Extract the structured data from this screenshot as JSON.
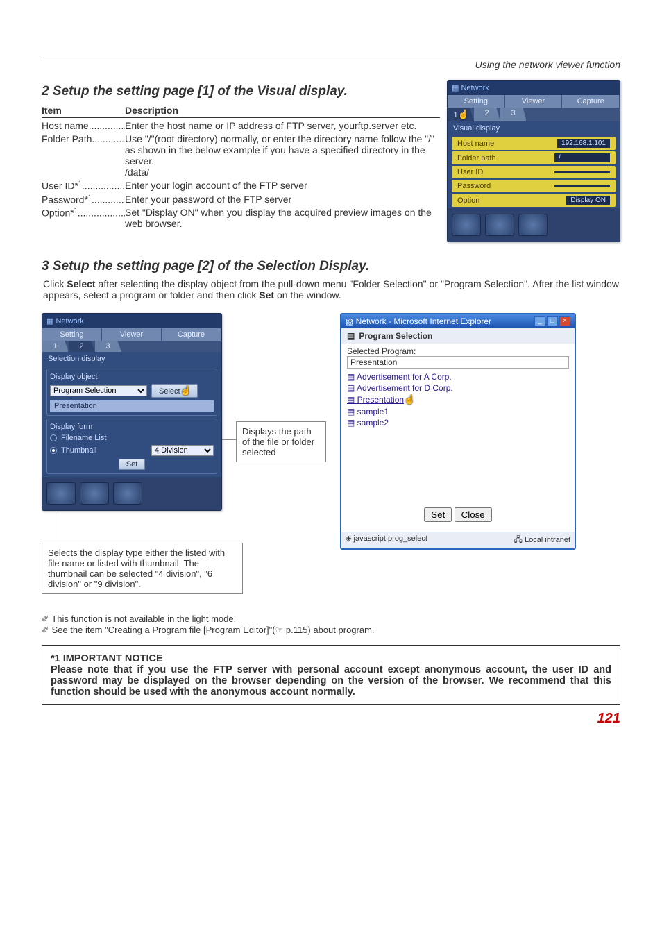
{
  "header": {
    "breadcrumb": "Using the network viewer function"
  },
  "section2": {
    "title": "2 Setup the setting page [1] of the Visual display.",
    "th_item": "Item",
    "th_desc": "Description",
    "rows": [
      {
        "name": "Host name",
        "dots": "................",
        "desc": "Enter the host name or IP address of FTP server, yourftp.server etc."
      },
      {
        "name": "Folder Path",
        "dots": "...............",
        "desc": "Use \"/\"(root directory) normally, or enter the directory name follow the \"/\" as shown in the below example if you have a specified directory in the server.\n/data/"
      },
      {
        "name": "User ID*",
        "sup": "1",
        "dots": "....................",
        "desc": "Enter your login account of the FTP server"
      },
      {
        "name": "Password*",
        "sup": "1",
        "dots": "...............",
        "desc": "Enter your password of the FTP server"
      },
      {
        "name": "Option*",
        "sup": "1",
        "dots": "...................",
        "desc": "Set \"Display ON\" when you display the acquired preview images on the web browser."
      }
    ],
    "panel": {
      "titlebar": "Network",
      "tabs": [
        "Setting",
        "Viewer",
        "Capture"
      ],
      "subtabs": [
        "1",
        "2",
        "3"
      ],
      "section_label": "Visual display",
      "rows": [
        {
          "label": "Host name",
          "value": "192.168.1.101"
        },
        {
          "label": "Folder path",
          "value": "/"
        },
        {
          "label": "User ID",
          "value": ""
        },
        {
          "label": "Password",
          "value": ""
        },
        {
          "label": "Option",
          "value": "Display ON"
        }
      ]
    }
  },
  "section3": {
    "title": "3 Setup the setting page [2] of the Selection Display.",
    "intro": "Click Select after selecting the display object from the pull-down menu \"Folder Selection\" or \"Program Selection\". After the list window appears, select a program or folder and then click Set on the window.",
    "intro_parts": {
      "p1": "Click ",
      "b1": "Select",
      "p2": " after selecting the display object from the pull-down menu \"Folder Selection\" or \"Program Selection\". After the list window appears, select a program or folder and then click ",
      "b2": "Set",
      "p3": " on the window."
    },
    "panel": {
      "titlebar": "Network",
      "tabs": [
        "Setting",
        "Viewer",
        "Capture"
      ],
      "subtabs": [
        "1",
        "2",
        "3"
      ],
      "section_label": "Selection display",
      "display_object_label": "Display object",
      "program_selection": "Program Selection",
      "select_btn": "Select",
      "presentation": "Presentation",
      "display_form_label": "Display form",
      "radios": [
        "Filename List",
        "Thumbnail"
      ],
      "division": "4 Division",
      "set_btn": "Set"
    },
    "callout_right": "Displays the path of the file or folder selected",
    "callout_bottom": "Selects the display type either the listed with file name or listed with thumbnail. The thumbnail can be selected \"4 division\", \"6 division\" or \"9 division\".",
    "iewin": {
      "title": "Network - Microsoft Internet Explorer",
      "header": "Program Selection",
      "selected_label": "Selected Program:",
      "selected_value": "Presentation",
      "items": [
        "Advertisement for A Corp.",
        "Advertisement for D Corp.",
        "Presentation",
        "sample1",
        "sample2"
      ],
      "btn_set": "Set",
      "btn_close": "Close",
      "status_left": "javascript:prog_select",
      "status_right": "Local intranet"
    }
  },
  "notes": {
    "n1": "This function is not available in the light mode.",
    "n2": "See the item \"Creating a Program file [Program Editor]\"(☞ p.115)  about program."
  },
  "important": {
    "heading": "*1 IMPORTANT NOTICE",
    "body": "Please note that if you use the FTP server with personal account except anonymous account, the user ID and password may be displayed on the browser depending on the version of the browser. We recommend that this function should be used with the anonymous account normally."
  },
  "page_number": "121"
}
